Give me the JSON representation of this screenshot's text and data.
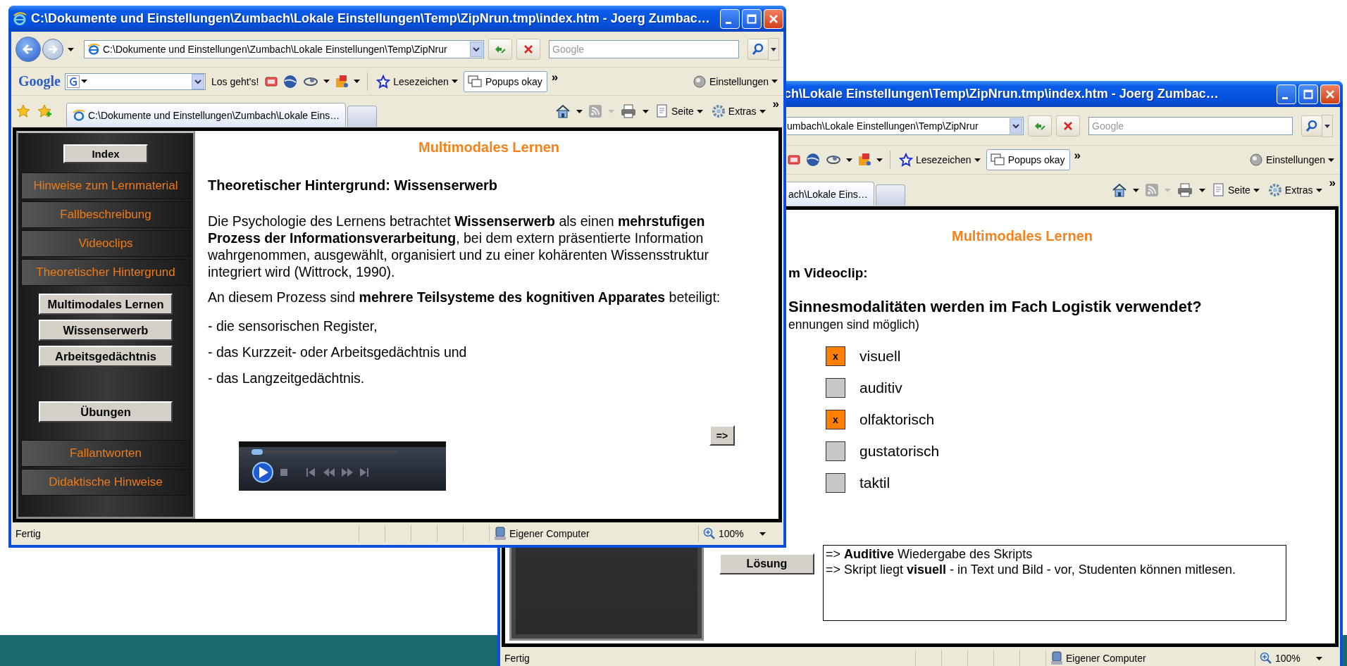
{
  "front_window": {
    "title": "C:\\Dokumente und Einstellungen\\Zumbach\\Lokale Einstellungen\\Temp\\ZipNrun.tmp\\index.htm - Joerg Zumbac…",
    "address": "C:\\Dokumente und Einstellungen\\Zumbach\\Lokale Einstellungen\\Temp\\ZipNrur",
    "search_placeholder": "Google",
    "google_logo": "Google",
    "go_button": "Los geht's!",
    "bookmarks": "Lesezeichen",
    "popups": "Popups okay",
    "more": "»",
    "settings": "Einstellungen",
    "tab": {
      "label": "C:\\Dokumente und Einstellungen\\Zumbach\\Lokale Eins…",
      "selected": true
    },
    "commands": [
      "Seite",
      "Extras"
    ],
    "commands_more": "»",
    "sidebar": {
      "index_button": "Index",
      "nav_top": [
        "Hinweise zum Lernmaterial",
        "Fallbeschreibung",
        "Videoclips",
        "Theoretischer Hintergrund"
      ],
      "sub_buttons": [
        "Multimodales Lernen",
        "Wissenserwerb",
        "Arbeitsgedächtnis"
      ],
      "exercises_button": "Übungen",
      "nav_bottom": [
        "Fallantworten",
        "Didaktische Hinweise"
      ]
    },
    "page": {
      "header": "Multimodales Lernen",
      "heading": "Theoretischer Hintergrund: Wissenserwerb",
      "paragraphs": [
        "Die Psychologie des Lernens betrachtet **Wissenserwerb** als einen **mehrstufigen Prozess der Informationsverarbeitung**, bei dem extern präsentierte Information wahrgenommen, ausgewählt, organisiert und zu einer kohärenten Wissensstruktur integriert wird (Wittrock, 1990).",
        "An diesem Prozess sind **mehrere Teilsysteme des kognitiven Apparates** beteiligt:"
      ],
      "list": [
        "- die sensorischen Register,",
        "- das Kurzzeit- oder Arbeitsgedächtnis und",
        "- das Langzeitgedächtnis."
      ],
      "next_button": "=>"
    },
    "status": {
      "text": "Fertig",
      "zone": "Eigener Computer",
      "zoom": "100%"
    }
  },
  "back_window": {
    "title": "ch\\Lokale Einstellungen\\Temp\\ZipNrun.tmp\\index.htm - Joerg Zumbac…",
    "address": "umbach\\Lokale Einstellungen\\Temp\\ZipNrur",
    "search_placeholder": "Google",
    "bookmarks": "Lesezeichen",
    "popups": "Popups okay",
    "more": "»",
    "settings": "Einstellungen",
    "tab": {
      "label": "ach\\Lokale Eins…",
      "selected": true
    },
    "commands": [
      "Seite",
      "Extras"
    ],
    "commands_more": "»",
    "page": {
      "header": "Multimodales Lernen",
      "subheading": "m Videoclip:",
      "question": "Sinnesmodalitäten werden im Fach Logistik verwendet?",
      "hint": "ennungen sind möglich)",
      "options": [
        {
          "label": "visuell",
          "checked": true,
          "mark": "x"
        },
        {
          "label": "auditiv",
          "checked": false
        },
        {
          "label": "olfaktorisch",
          "checked": true,
          "mark": "x"
        },
        {
          "label": "gustatorisch",
          "checked": false
        },
        {
          "label": "taktil",
          "checked": false
        }
      ],
      "solution_button": "Lösung",
      "answer_lines": [
        "=> **Auditive** Wiedergabe des Skripts",
        "=> Skript liegt **visuell** - in Text und Bild - vor, Studenten können mitlesen."
      ]
    },
    "status": {
      "text": "Fertig",
      "zone": "Eigener Computer",
      "zoom": "100%"
    }
  }
}
